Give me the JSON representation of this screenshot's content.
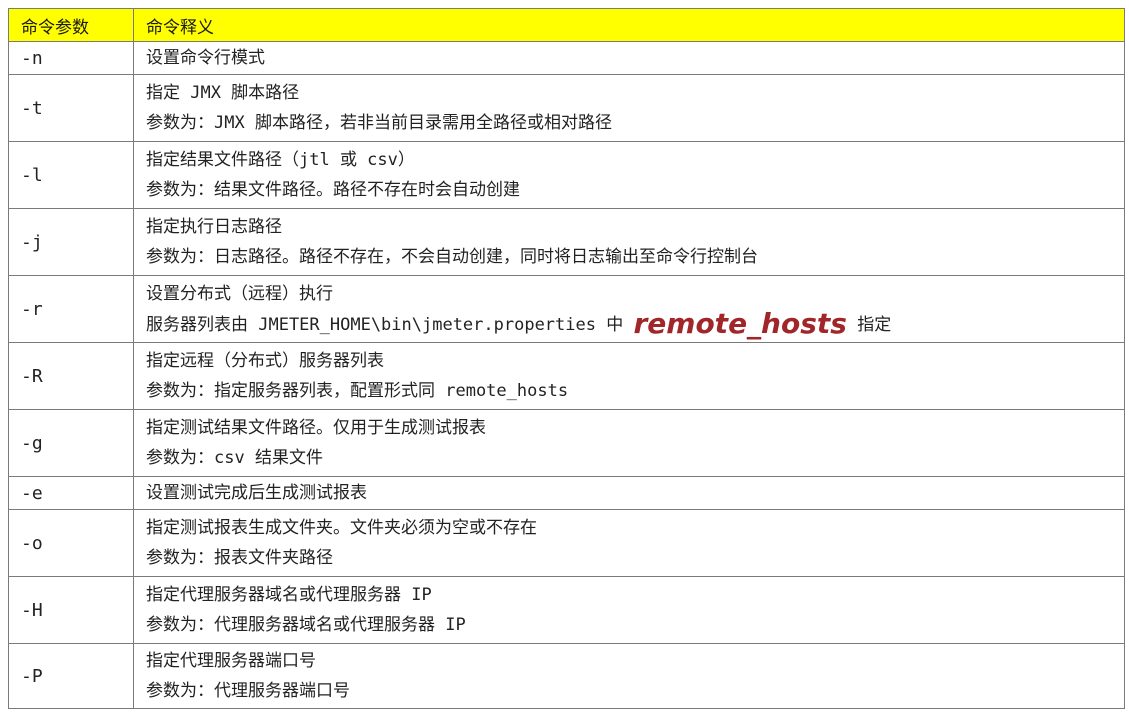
{
  "header": {
    "col1": "命令参数",
    "col2": "命令释义"
  },
  "rows": [
    {
      "param": "-n",
      "line1": "设置命令行模式"
    },
    {
      "param": "-t",
      "line1": "指定 JMX 脚本路径",
      "line2": "参数为：JMX 脚本路径，若非当前目录需用全路径或相对路径"
    },
    {
      "param": "-l",
      "line1": "指定结果文件路径（jtl 或 csv）",
      "line2": "参数为：结果文件路径。路径不存在时会自动创建"
    },
    {
      "param": "-j",
      "line1": "指定执行日志路径",
      "line2": "参数为：日志路径。路径不存在，不会自动创建，同时将日志输出至命令行控制台"
    },
    {
      "param": "-r",
      "line1": "设置分布式（远程）执行",
      "line2_pre": "服务器列表由 JMETER_HOME\\bin\\jmeter.properties 中 ",
      "line2_highlight": "remote_hosts",
      "line2_post": " 指定"
    },
    {
      "param": "-R",
      "line1": "指定远程（分布式）服务器列表",
      "line2": "参数为：指定服务器列表，配置形式同 remote_hosts"
    },
    {
      "param": "-g",
      "line1": "指定测试结果文件路径。仅用于生成测试报表",
      "line2": "参数为：csv 结果文件"
    },
    {
      "param": "-e",
      "line1": "设置测试完成后生成测试报表"
    },
    {
      "param": "-o",
      "line1": "指定测试报表生成文件夹。文件夹必须为空或不存在",
      "line2": "参数为：报表文件夹路径"
    },
    {
      "param": "-H",
      "line1": "指定代理服务器域名或代理服务器 IP",
      "line2": "参数为：代理服务器域名或代理服务器 IP"
    },
    {
      "param": "-P",
      "line1": "指定代理服务器端口号",
      "line2": "参数为：代理服务器端口号"
    }
  ],
  "colors": {
    "header_bg": "#ffff00",
    "border": "#7a7a7a",
    "annotation": "#a0262a"
  }
}
